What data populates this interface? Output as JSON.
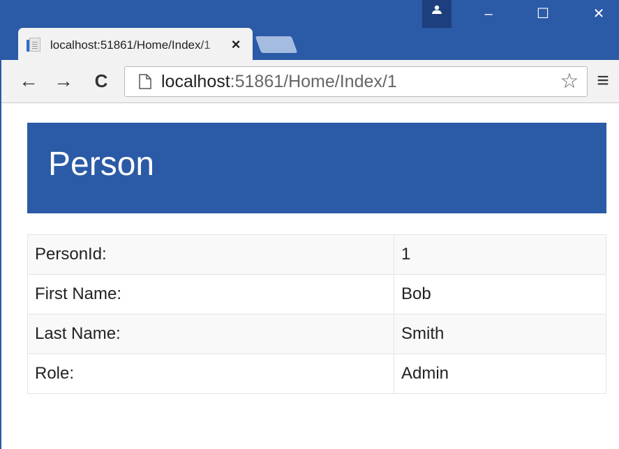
{
  "browser": {
    "tab_title": "localhost:51861/Home/Index/1",
    "tab_close": "×",
    "minimize": "–",
    "maximize": "☐",
    "close": "✕",
    "back": "←",
    "forward": "→",
    "reload": "C",
    "url_host": "localhost",
    "url_path": ":51861/Home/Index/1",
    "bookmark_star": "☆",
    "menu": "≡"
  },
  "page": {
    "heading": "Person",
    "rows": [
      {
        "label": "PersonId:",
        "value": "1"
      },
      {
        "label": "First Name:",
        "value": "Bob"
      },
      {
        "label": "Last Name:",
        "value": "Smith"
      },
      {
        "label": "Role:",
        "value": "Admin"
      }
    ]
  },
  "colors": {
    "titlebar": "#2b5aa6",
    "header_panel": "#2b5aa6",
    "toolbar": "#f2f2f2",
    "profile_button": "#1d3f7d"
  },
  "icons": [
    "page-icon",
    "profile-icon",
    "star-icon",
    "menu-icon"
  ]
}
